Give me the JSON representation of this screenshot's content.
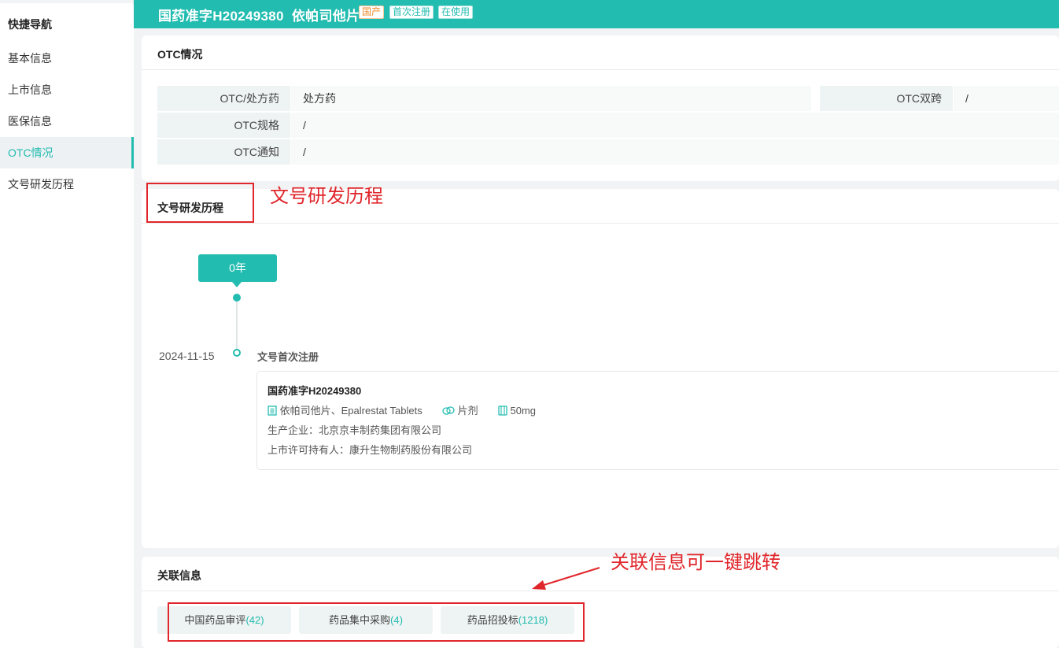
{
  "sidebar": {
    "title": "快捷导航",
    "items": [
      {
        "label": "基本信息"
      },
      {
        "label": "上市信息"
      },
      {
        "label": "医保信息"
      },
      {
        "label": "OTC情况",
        "active": true
      },
      {
        "label": "文号研发历程"
      }
    ]
  },
  "header": {
    "title": "国药准字H20249380  依帕司他片",
    "tags": [
      "国产",
      "首次注册",
      "在使用"
    ]
  },
  "otc": {
    "section_title": "OTC情况",
    "rows": [
      {
        "label": "OTC/处方药",
        "value": "处方药"
      },
      {
        "label": "OTC规格",
        "value": "/"
      },
      {
        "label": "OTC通知",
        "value": "/"
      }
    ],
    "dual": {
      "label": "OTC双跨",
      "value": "/"
    }
  },
  "history": {
    "section_title": "文号研发历程",
    "year_badge": "0年",
    "date": "2024-11-15",
    "event": "文号首次注册",
    "detail": {
      "approval_no": "国药准字H20249380",
      "name": "依帕司他片、Epalrestat Tablets",
      "form": "片剂",
      "spec": "50mg",
      "manufacturer": "生产企业：北京京丰制药集团有限公司",
      "holder": "上市许可持有人：康升生物制药股份有限公司"
    }
  },
  "related": {
    "section_title": "关联信息",
    "buttons": [
      {
        "label": "中国药品审评",
        "count": "(42)"
      },
      {
        "label": "药品集中采购",
        "count": "(4)"
      },
      {
        "label": "药品招投标",
        "count": "(1218)"
      }
    ]
  },
  "annotations": {
    "history_note": "文号研发历程",
    "related_note": "关联信息可一键跳转"
  },
  "colors": {
    "accent": "#22bcb0",
    "annotation": "#e0262b",
    "tag_orange": "#f08a2a"
  }
}
